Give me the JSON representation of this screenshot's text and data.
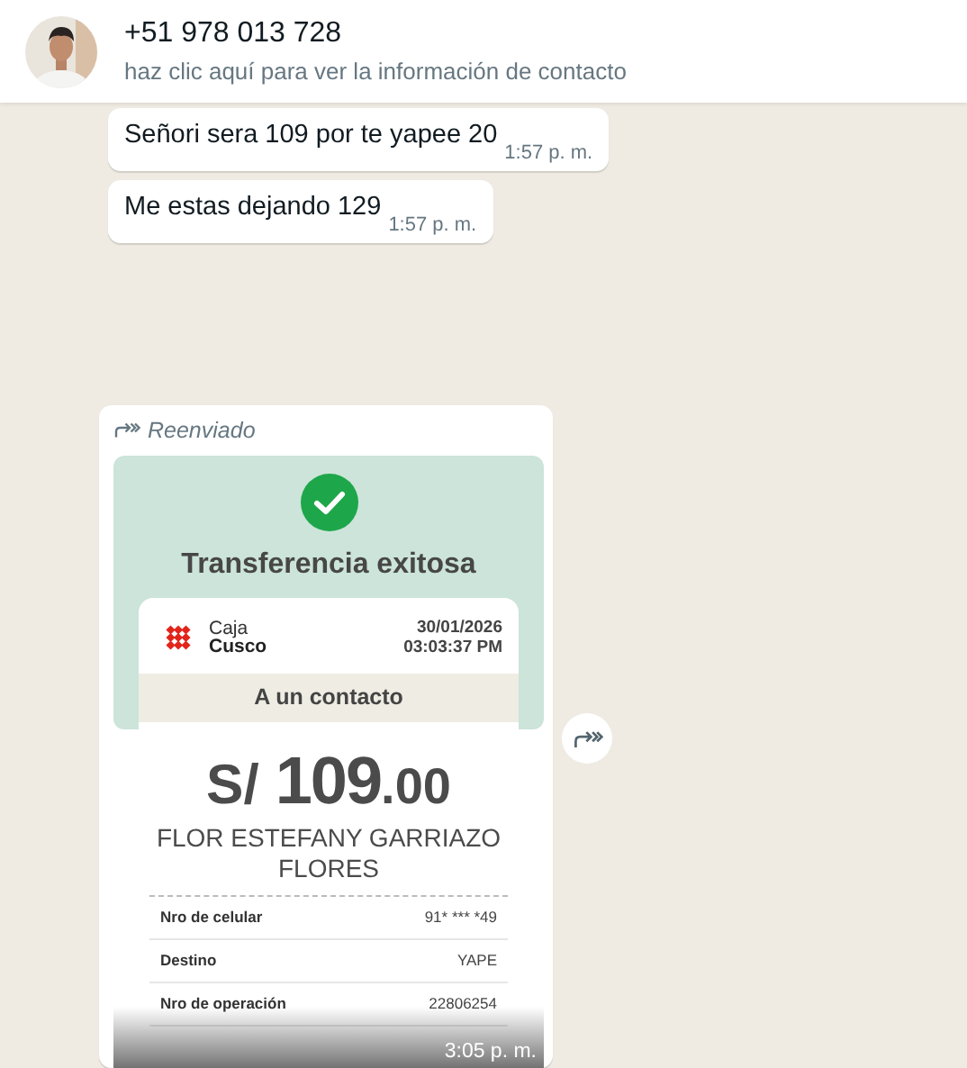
{
  "header": {
    "contact_name": "+51 978 013 728",
    "subtitle": "haz clic aquí para ver la información de contacto"
  },
  "messages": [
    {
      "kind": "text",
      "text": "Señori sera 109 por te yapee 20",
      "time": "1:57 p. m."
    },
    {
      "kind": "text",
      "text": "Me estas dejando 129",
      "time": "1:57 p. m."
    },
    {
      "kind": "receipt",
      "forwarded_label": "Reenviado",
      "time": "3:05 p. m.",
      "receipt": {
        "status": "Transferencia exitosa",
        "bank_line_1": "Caja",
        "bank_line_2": "Cusco",
        "date": "30/01/2026",
        "clock": "03:03:37 PM",
        "category": "A un contacto",
        "currency": "S/",
        "amount_whole": "109",
        "amount_decimals": ".00",
        "recipient": "FLOR ESTEFANY GARRIAZO FLORES",
        "details": [
          {
            "label": "Nro de celular",
            "value": "91* *** *49"
          },
          {
            "label": "Destino",
            "value": "YAPE"
          },
          {
            "label": "Nro de operación",
            "value": "22806254"
          }
        ]
      }
    }
  ]
}
